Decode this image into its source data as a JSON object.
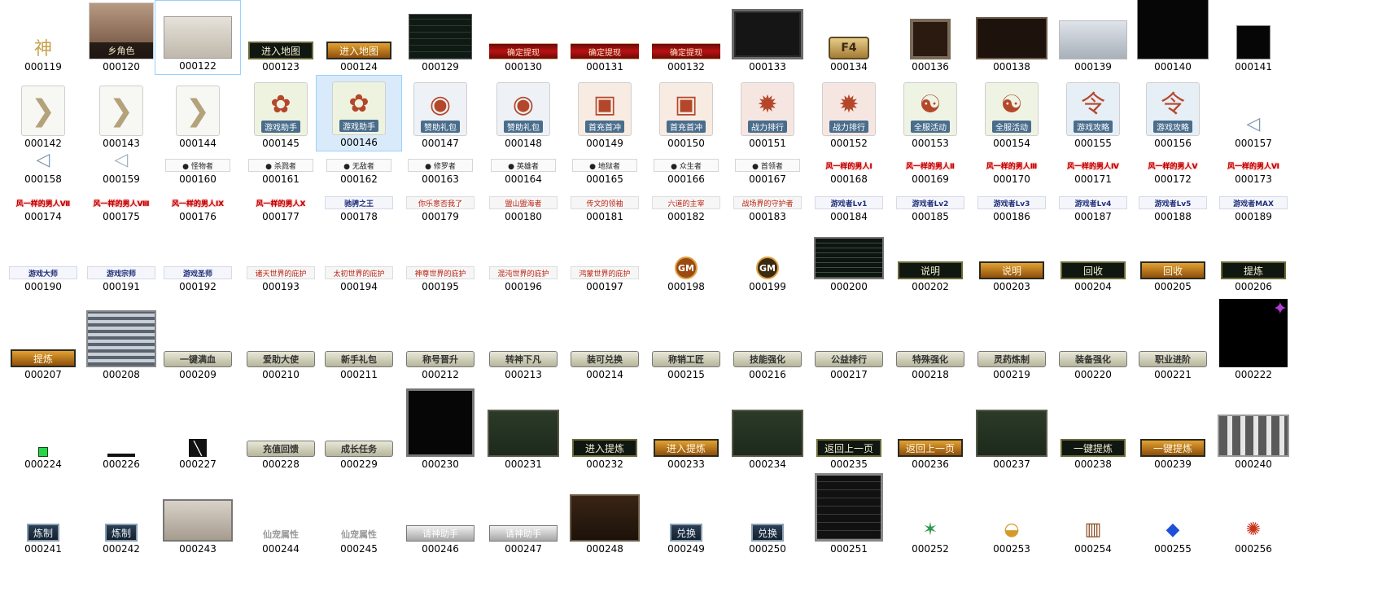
{
  "grid": {
    "row_tops": [
      0,
      92,
      186,
      230,
      276,
      362,
      470,
      580
    ],
    "row_heights": [
      92,
      94,
      44,
      46,
      86,
      108,
      110,
      104
    ],
    "col_lefts": [
      0,
      96,
      190,
      292,
      388,
      488,
      590,
      690,
      790,
      890,
      990,
      1090,
      1190,
      1290,
      1388,
      1488
    ],
    "colors": {
      "selected_bg": "#d9ebfb",
      "selected_border": "#99d1ff"
    }
  },
  "items": [
    {
      "label": "000119",
      "kind": "small",
      "icon": "神",
      "color": "#c7a14a"
    },
    {
      "label": "000120",
      "kind": "portrait",
      "text": "乡角色"
    },
    {
      "label": "000122",
      "kind": "panel-light",
      "state": "focus"
    },
    {
      "label": "000123",
      "kind": "btn-dark",
      "text": "进入地图"
    },
    {
      "label": "000124",
      "kind": "btn-gold",
      "text": "进入地图"
    },
    {
      "label": "000129",
      "kind": "panel-grid"
    },
    {
      "label": "000130",
      "kind": "bar-red",
      "text": "确定提现"
    },
    {
      "label": "000131",
      "kind": "bar-red",
      "text": "确定提现"
    },
    {
      "label": "000132",
      "kind": "bar-red",
      "text": "确定提现"
    },
    {
      "label": "000133",
      "kind": "panel-dark"
    },
    {
      "label": "000134",
      "kind": "f4",
      "text": "F4"
    },
    {
      "label": "000136",
      "kind": "frame-small"
    },
    {
      "label": "000138",
      "kind": "panel-brown"
    },
    {
      "label": "000139",
      "kind": "panel-blur"
    },
    {
      "label": "000140",
      "kind": "panel-black-lg"
    },
    {
      "label": "000141",
      "kind": "panel-black-sm"
    },
    {
      "label": "000142",
      "kind": "chevron"
    },
    {
      "label": "000143",
      "kind": "chevron"
    },
    {
      "label": "000144",
      "kind": "chevron"
    },
    {
      "label": "000145",
      "kind": "medal",
      "pic": "✿",
      "cap": "游戏助手",
      "bg": "#eef3e0"
    },
    {
      "label": "000146",
      "kind": "medal",
      "pic": "✿",
      "cap": "游戏助手",
      "bg": "#eef3e0",
      "state": "selected"
    },
    {
      "label": "000147",
      "kind": "medal",
      "pic": "◉",
      "cap": "赞助礼包",
      "bg": "#eef2f6"
    },
    {
      "label": "000148",
      "kind": "medal",
      "pic": "◉",
      "cap": "赞助礼包",
      "bg": "#eef2f6"
    },
    {
      "label": "000149",
      "kind": "medal",
      "pic": "▣",
      "cap": "首充首冲",
      "bg": "#f7ebe2"
    },
    {
      "label": "000150",
      "kind": "medal",
      "pic": "▣",
      "cap": "首充首冲",
      "bg": "#f7ebe2"
    },
    {
      "label": "000151",
      "kind": "medal",
      "pic": "✹",
      "cap": "战力排行",
      "bg": "#f6e6e2"
    },
    {
      "label": "000152",
      "kind": "medal",
      "pic": "✹",
      "cap": "战力排行",
      "bg": "#f6e6e2"
    },
    {
      "label": "000153",
      "kind": "medal",
      "pic": "☯",
      "cap": "全服活动",
      "bg": "#eef3e4"
    },
    {
      "label": "000154",
      "kind": "medal",
      "pic": "☯",
      "cap": "全服活动",
      "bg": "#eef3e4"
    },
    {
      "label": "000155",
      "kind": "medal",
      "pic": "令",
      "cap": "游戏攻略",
      "bg": "#e6eef6"
    },
    {
      "label": "000156",
      "kind": "medal",
      "pic": "令",
      "cap": "游戏攻略",
      "bg": "#e6eef6"
    },
    {
      "label": "000157",
      "kind": "small",
      "icon": "◁",
      "color": "#7a93ad"
    },
    {
      "label": "000158",
      "kind": "small",
      "icon": "◁",
      "color": "#7a93ad"
    },
    {
      "label": "000159",
      "kind": "small",
      "icon": "◁",
      "color": "#9fb0c2"
    },
    {
      "label": "000160",
      "kind": "chip-white",
      "text": "● 怪物者"
    },
    {
      "label": "000161",
      "kind": "chip-white",
      "text": "● 杀戮者"
    },
    {
      "label": "000162",
      "kind": "chip-white",
      "text": "● 无敌者"
    },
    {
      "label": "000163",
      "kind": "chip-white",
      "text": "● 修罗者"
    },
    {
      "label": "000164",
      "kind": "chip-white",
      "text": "● 英雄者"
    },
    {
      "label": "000165",
      "kind": "chip-white",
      "text": "● 地狱者"
    },
    {
      "label": "000166",
      "kind": "chip-white",
      "text": "● 众生者"
    },
    {
      "label": "000167",
      "kind": "chip-white",
      "text": "● 首领者"
    },
    {
      "label": "000168",
      "kind": "chip-red",
      "text": "风一样的男人Ⅰ"
    },
    {
      "label": "000169",
      "kind": "chip-red",
      "text": "风一样的男人Ⅱ"
    },
    {
      "label": "000170",
      "kind": "chip-red",
      "text": "风一样的男人Ⅲ"
    },
    {
      "label": "000171",
      "kind": "chip-red",
      "text": "风一样的男人Ⅳ"
    },
    {
      "label": "000172",
      "kind": "chip-red",
      "text": "风一样的男人Ⅴ"
    },
    {
      "label": "000173",
      "kind": "chip-red",
      "text": "风一样的男人Ⅵ"
    },
    {
      "label": "000174",
      "kind": "chip-red",
      "text": "风一样的男人Ⅶ"
    },
    {
      "label": "000175",
      "kind": "chip-red",
      "text": "风一样的男人Ⅷ"
    },
    {
      "label": "000176",
      "kind": "chip-red",
      "text": "风一样的男人Ⅸ"
    },
    {
      "label": "000177",
      "kind": "chip-red",
      "text": "风一样的男人Ⅹ"
    },
    {
      "label": "000178",
      "kind": "chip-blue",
      "text": "驰骋之王"
    },
    {
      "label": "000179",
      "kind": "chip-ltred",
      "text": "你乐意否我了"
    },
    {
      "label": "000180",
      "kind": "chip-ltred",
      "text": "盟山盟海者"
    },
    {
      "label": "000181",
      "kind": "chip-ltred",
      "text": "传文的领袖"
    },
    {
      "label": "000182",
      "kind": "chip-ltred",
      "text": "六道的主宰"
    },
    {
      "label": "000183",
      "kind": "chip-ltred",
      "text": "战场界的守护者"
    },
    {
      "label": "000184",
      "kind": "chip-blue",
      "text": "游戏者Lv1"
    },
    {
      "label": "000185",
      "kind": "chip-blue",
      "text": "游戏者Lv2"
    },
    {
      "label": "000186",
      "kind": "chip-blue",
      "text": "游戏者Lv3"
    },
    {
      "label": "000187",
      "kind": "chip-blue",
      "text": "游戏者Lv4"
    },
    {
      "label": "000188",
      "kind": "chip-blue",
      "text": "游戏者Lv5"
    },
    {
      "label": "000189",
      "kind": "chip-blue",
      "text": "游戏者MAX"
    },
    {
      "label": "000190",
      "kind": "chip-blue",
      "text": "游戏大师"
    },
    {
      "label": "000191",
      "kind": "chip-blue",
      "text": "游戏宗师"
    },
    {
      "label": "000192",
      "kind": "chip-blue",
      "text": "游戏圣师"
    },
    {
      "label": "000193",
      "kind": "chip-ltred",
      "text": "诸天世界的庇护"
    },
    {
      "label": "000194",
      "kind": "chip-ltred",
      "text": "太初世界的庇护"
    },
    {
      "label": "000195",
      "kind": "chip-ltred",
      "text": "神尊世界的庇护"
    },
    {
      "label": "000196",
      "kind": "chip-ltred",
      "text": "混沌世界的庇护"
    },
    {
      "label": "000197",
      "kind": "chip-ltred",
      "text": "鸿蒙世界的庇护"
    },
    {
      "label": "000198",
      "kind": "gm",
      "text": "GM",
      "bg": "#9b4a12"
    },
    {
      "label": "000199",
      "kind": "gm",
      "text": "GM",
      "bg": "#3a2a10"
    },
    {
      "label": "000200",
      "kind": "panel-list"
    },
    {
      "label": "000202",
      "kind": "btn-dark",
      "text": "说明"
    },
    {
      "label": "000203",
      "kind": "btn-gold",
      "text": "说明"
    },
    {
      "label": "000204",
      "kind": "btn-dark",
      "text": "回收"
    },
    {
      "label": "000205",
      "kind": "btn-gold",
      "text": "回收"
    },
    {
      "label": "000206",
      "kind": "btn-dark",
      "text": "提炼"
    },
    {
      "label": "000207",
      "kind": "btn-gold",
      "text": "提炼"
    },
    {
      "label": "000208",
      "kind": "panel-rows"
    },
    {
      "label": "000209",
      "kind": "scroll",
      "text": "一键满血"
    },
    {
      "label": "000210",
      "kind": "scroll",
      "text": "爱助大使"
    },
    {
      "label": "000211",
      "kind": "scroll",
      "text": "新手礼包"
    },
    {
      "label": "000212",
      "kind": "scroll",
      "text": "称号晋升"
    },
    {
      "label": "000213",
      "kind": "scroll",
      "text": "转神下凡"
    },
    {
      "label": "000214",
      "kind": "scroll",
      "text": "装可兑换"
    },
    {
      "label": "000215",
      "kind": "scroll",
      "text": "称销工匠"
    },
    {
      "label": "000216",
      "kind": "scroll",
      "text": "技能强化"
    },
    {
      "label": "000217",
      "kind": "scroll",
      "text": "公益排行"
    },
    {
      "label": "000218",
      "kind": "scroll",
      "text": "特殊强化"
    },
    {
      "label": "000219",
      "kind": "scroll",
      "text": "灵药炼制"
    },
    {
      "label": "000220",
      "kind": "scroll",
      "text": "装备强化"
    },
    {
      "label": "000221",
      "kind": "scroll",
      "text": "职业进阶"
    },
    {
      "label": "000222",
      "kind": "panel-space"
    },
    {
      "label": "000224",
      "kind": "dot"
    },
    {
      "label": "000226",
      "kind": "dash"
    },
    {
      "label": "000227",
      "kind": "slash"
    },
    {
      "label": "000228",
      "kind": "scroll",
      "text": "充值回馈"
    },
    {
      "label": "000229",
      "kind": "scroll",
      "text": "成长任务"
    },
    {
      "label": "000230",
      "kind": "panel-black-tall"
    },
    {
      "label": "000231",
      "kind": "panel-green"
    },
    {
      "label": "000232",
      "kind": "btn-dark",
      "text": "进入提炼"
    },
    {
      "label": "000233",
      "kind": "btn-gold",
      "text": "进入提炼"
    },
    {
      "label": "000234",
      "kind": "panel-green"
    },
    {
      "label": "000235",
      "kind": "btn-dark",
      "text": "返回上一页"
    },
    {
      "label": "000236",
      "kind": "btn-gold",
      "text": "返回上一页"
    },
    {
      "label": "000237",
      "kind": "panel-green"
    },
    {
      "label": "000238",
      "kind": "btn-dark",
      "text": "一键提炼"
    },
    {
      "label": "000239",
      "kind": "btn-gold",
      "text": "一键提炼"
    },
    {
      "label": "000240",
      "kind": "panel-slots"
    },
    {
      "label": "000241",
      "kind": "btn-blue",
      "text": "炼制"
    },
    {
      "label": "000242",
      "kind": "btn-blue",
      "text": "炼制"
    },
    {
      "label": "000243",
      "kind": "panel-items"
    },
    {
      "label": "000244",
      "kind": "gray-text",
      "text": "仙宠属性"
    },
    {
      "label": "000245",
      "kind": "gray-text",
      "text": "仙宠属性"
    },
    {
      "label": "000246",
      "kind": "gray-btn",
      "text": "请神助手"
    },
    {
      "label": "000247",
      "kind": "gray-btn",
      "text": "请神助手"
    },
    {
      "label": "000248",
      "kind": "panel-red"
    },
    {
      "label": "000249",
      "kind": "btn-blue",
      "text": "兑换"
    },
    {
      "label": "000250",
      "kind": "btn-blue",
      "text": "兑换"
    },
    {
      "label": "000251",
      "kind": "panel-menu"
    },
    {
      "label": "000252",
      "kind": "small",
      "icon": "✶",
      "color": "#2c9a4a"
    },
    {
      "label": "000253",
      "kind": "small",
      "icon": "◒",
      "color": "#d39b2a"
    },
    {
      "label": "000254",
      "kind": "small",
      "icon": "▥",
      "color": "#8a4a22"
    },
    {
      "label": "000255",
      "kind": "small",
      "icon": "◆",
      "color": "#1f4fd8"
    },
    {
      "label": "000256",
      "kind": "small",
      "icon": "✺",
      "color": "#c8331a"
    }
  ]
}
